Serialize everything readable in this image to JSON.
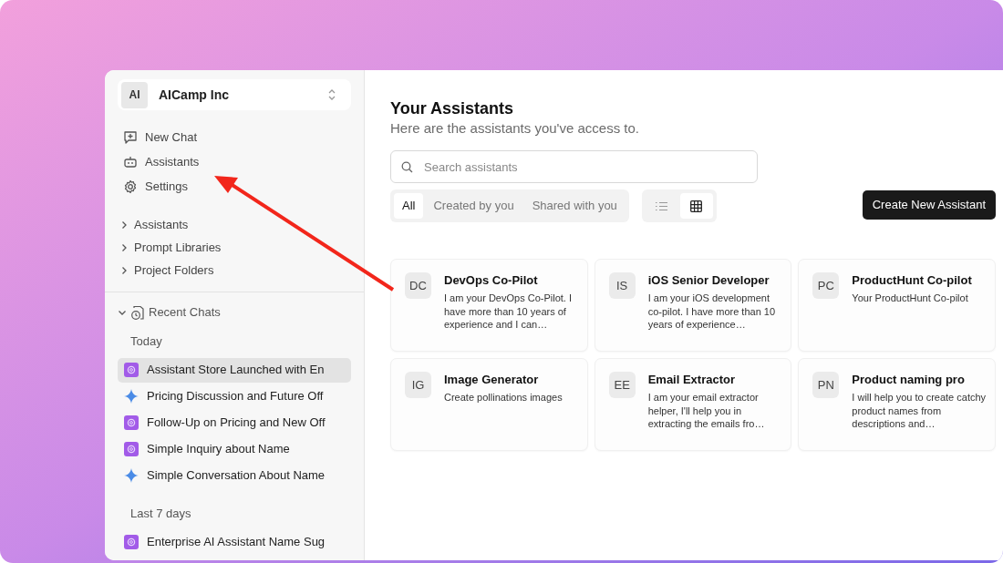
{
  "workspace": {
    "initials": "AI",
    "name": "AICamp Inc"
  },
  "nav": [
    {
      "kind": "new-chat",
      "label": "New Chat"
    },
    {
      "kind": "assistants",
      "label": "Assistants"
    },
    {
      "kind": "settings",
      "label": "Settings"
    }
  ],
  "sections": [
    {
      "label": "Assistants",
      "expanded": false
    },
    {
      "label": "Prompt Libraries",
      "expanded": false
    },
    {
      "label": "Project Folders",
      "expanded": false
    }
  ],
  "recent_chats": {
    "label": "Recent Chats",
    "expanded": true,
    "groups": [
      {
        "label": "Today",
        "items": [
          {
            "kind": "openai",
            "title": "Assistant Store Launched with En",
            "selected": true
          },
          {
            "kind": "gemini",
            "title": "Pricing Discussion and Future Off",
            "selected": false
          },
          {
            "kind": "openai",
            "title": "Follow-Up on Pricing and New Off",
            "selected": false
          },
          {
            "kind": "openai",
            "title": "Simple Inquiry about Name",
            "selected": false
          },
          {
            "kind": "gemini",
            "title": "Simple Conversation About Name",
            "selected": false
          }
        ]
      },
      {
        "label": "Last 7 days",
        "items": [
          {
            "kind": "openai",
            "title": "Enterprise AI Assistant Name Sug",
            "selected": false
          }
        ]
      }
    ]
  },
  "header": {
    "title": "Your Assistants",
    "subtitle": "Here are the assistants you've access to."
  },
  "search": {
    "placeholder": "Search assistants"
  },
  "filters": [
    {
      "label": "All",
      "selected": true
    },
    {
      "label": "Created by you",
      "selected": false
    },
    {
      "label": "Shared with you",
      "selected": false
    }
  ],
  "views": [
    {
      "kind": "list",
      "selected": false
    },
    {
      "kind": "grid",
      "selected": true
    }
  ],
  "create_button": "Create New Assistant",
  "assistants": [
    {
      "initials": "DC",
      "name": "DevOps Co-Pilot",
      "description": "I am your DevOps Co-Pilot. I have more than 10 years of experience and I can…"
    },
    {
      "initials": "IS",
      "name": "iOS Senior Developer",
      "description": "I am your iOS development co-pilot. I have more than 10 years of experience…"
    },
    {
      "initials": "PC",
      "name": "ProductHunt Co-pilot",
      "description": "Your ProductHunt Co-pilot"
    },
    {
      "initials": "IG",
      "name": "Image Generator",
      "description": "Create pollinations images"
    },
    {
      "initials": "EE",
      "name": "Email Extractor",
      "description": "I am your email extractor helper, I'll help you in extracting the emails fro…"
    },
    {
      "initials": "PN",
      "name": "Product naming pro",
      "description": "I will help you to create catchy product names from descriptions and…"
    }
  ]
}
